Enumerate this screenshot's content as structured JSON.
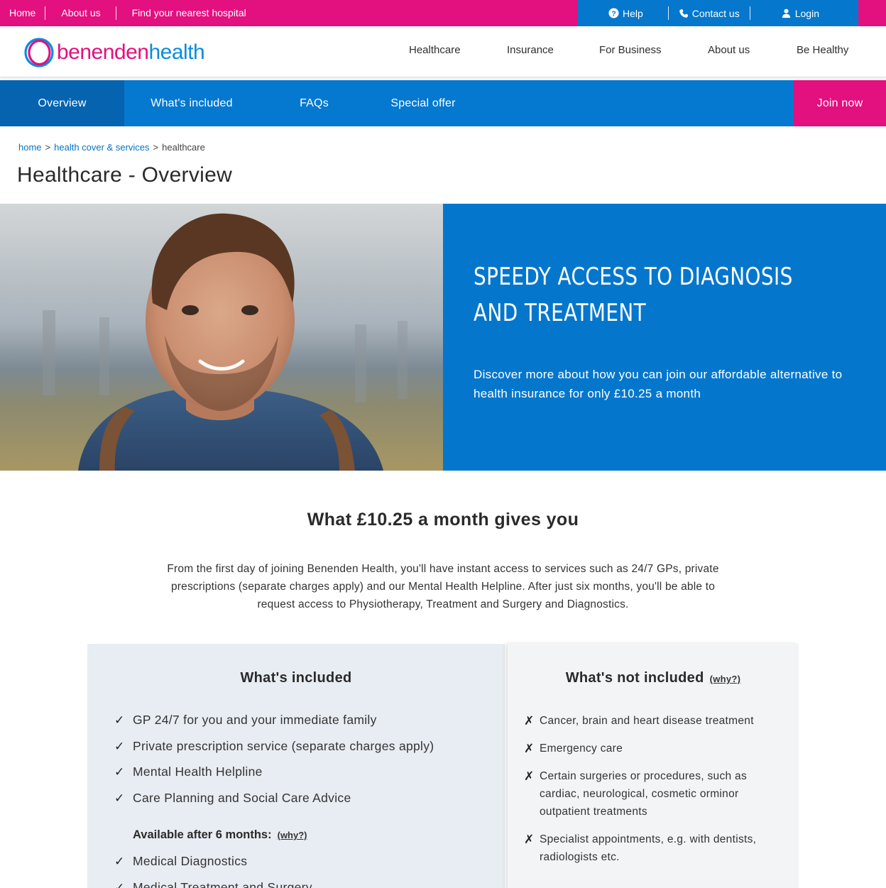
{
  "topbar": {
    "links": [
      "Home",
      "About us",
      "Find your nearest hospital"
    ],
    "help": "Help",
    "contact": "Contact us",
    "login": "Login"
  },
  "brand": {
    "part1": "benenden",
    "part2": "health",
    "pink": "#e3107f",
    "blue": "#0a8be0"
  },
  "mainnav": [
    "Healthcare",
    "Insurance",
    "For Business",
    "About us",
    "Be Healthy"
  ],
  "subnav": {
    "items": [
      "Overview",
      "What's included",
      "FAQs",
      "Special offer"
    ],
    "join": "Join now"
  },
  "breadcrumb": {
    "home": "home",
    "cover": "health cover & services",
    "current": "healthcare",
    "sep": ">"
  },
  "page_title": "Healthcare - Overview",
  "hero": {
    "heading_line1": "Speedy access to diagnosis",
    "heading_line2": "and treatment",
    "subtext": "Discover more about how you can join our affordable alternative to health insurance for only £10.25 a month"
  },
  "value": {
    "title": "What £10.25 a month gives you",
    "description": "From the first day of joining Benenden Health, you'll have instant access to services such as 24/7 GPs, private prescriptions (separate charges apply) and our Mental Health Helpline. After just six months, you'll be able to request access to Physiotherapy, Treatment and Surgery and Diagnostics."
  },
  "included": {
    "title": "What's included",
    "items": [
      "GP 24/7 for you and your immediate family",
      "Private prescription service (separate charges apply)",
      "Mental Health Helpline",
      "Care Planning and Social Care Advice"
    ],
    "available_label": "Available after 6 months:",
    "why": "(why?)",
    "after_items": [
      "Medical Diagnostics",
      "Medical Treatment and Surgery"
    ]
  },
  "not_included": {
    "title": "What's not included",
    "why": "(why?)",
    "items": [
      "Cancer, brain and heart disease treatment",
      "Emergency care",
      "Certain surgeries or procedures, such as cardiac, neurological, cosmetic orminor outpatient treatments",
      "Specialist appointments, e.g. with dentists, radiologists etc."
    ]
  },
  "colors": {
    "pink": "#e3107f",
    "blue": "#0578cf",
    "dark_blue": "#0563b0"
  },
  "icons": {
    "help": "question-circle-icon",
    "contact": "phone-icon",
    "login": "user-icon",
    "tick": "check-icon",
    "cross": "cross-icon"
  }
}
